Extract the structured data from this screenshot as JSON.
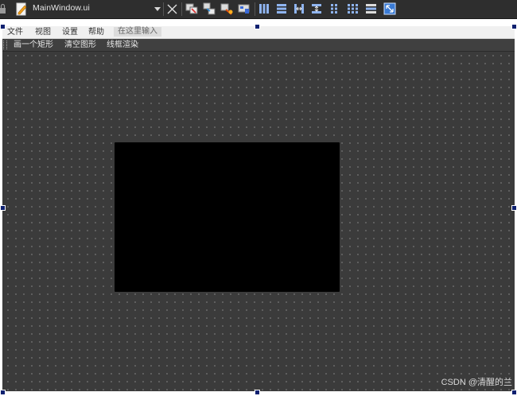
{
  "editor_tab": {
    "file_name": "MainWindow.ui"
  },
  "menubar": {
    "items": [
      "文件",
      "视图",
      "设置",
      "帮助"
    ],
    "input_placeholder": "在这里输入"
  },
  "toolbar": {
    "actions": [
      "画一个矩形",
      "清空图形",
      "线框渲染"
    ]
  },
  "toolbar_icons": [
    "edit-widgets-icon",
    "edit-signals-slots-icon",
    "edit-buddies-icon",
    "edit-tab-order-icon",
    "layout-horizontal-icon",
    "layout-vertical-icon",
    "layout-horizontal-splitter-icon",
    "layout-vertical-splitter-icon",
    "layout-form-icon",
    "layout-grid-icon",
    "break-layout-icon",
    "adjust-size-icon"
  ],
  "watermark": "CSDN @清醒的兰",
  "colors": {
    "canvas": "#3b3b3b",
    "handle": "#0f2170",
    "gl_widget": "#000000"
  }
}
